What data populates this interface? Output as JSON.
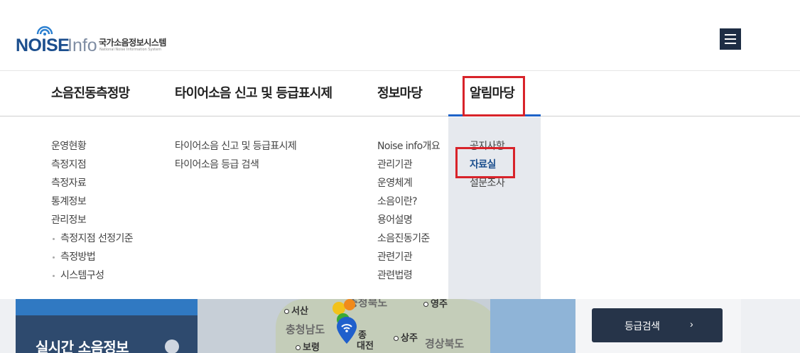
{
  "header": {
    "logo": {
      "brand": "NOISE",
      "info": "Info",
      "korean": "국가소음정보시스템",
      "english": "National Noise Information System"
    },
    "menu_icon": "hamburger-icon",
    "colors": {
      "brand": "#1c4f8e",
      "menu_bg": "#1e2d44"
    }
  },
  "nav": {
    "items": [
      {
        "label": "소음진동측정망"
      },
      {
        "label": "타이어소음 신고 및 등급표시제"
      },
      {
        "label": "정보마당"
      },
      {
        "label": "알림마당"
      }
    ],
    "active_index": 3,
    "colors": {
      "active_bar": "#1e63c8",
      "highlight_box": "#d8232a"
    }
  },
  "mega": {
    "col1": {
      "links": [
        "운영현황",
        "측정지점",
        "측정자료",
        "통계정보",
        "관리정보"
      ],
      "subs": [
        "측정지점 선정기준",
        "측정방법",
        "시스템구성"
      ]
    },
    "col2": {
      "links": [
        "타이어소음 신고 및 등급표시제",
        "타이어소음 등급 검색"
      ]
    },
    "col3": {
      "links": [
        "Noise info개요",
        "관리기관",
        "운영체계",
        "소음이란?",
        "용어설명",
        "소음진동기준",
        "관련기관",
        "관련법령"
      ]
    },
    "col4": {
      "links": [
        "공지사항",
        "자료실",
        "설문조사"
      ],
      "selected_index": 1
    }
  },
  "below": {
    "realtime_title": "실시간 소음정보",
    "refresh_icon": "refresh-icon",
    "map_labels": {
      "seosan": "서산",
      "chungnam": "충청남도",
      "boryeong": "보령",
      "daejeon": "대전",
      "sangju": "상주",
      "gyeongbuk": "경상북도",
      "yeongju": "영주",
      "chungbuk": "충청북도",
      "sejong": "종"
    },
    "grade_search": {
      "label": "등급검색",
      "chevron": "›"
    }
  }
}
